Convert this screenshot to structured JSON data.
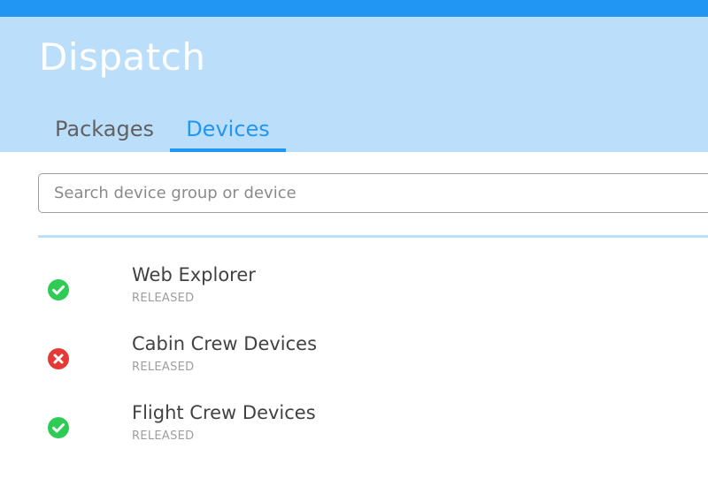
{
  "app": {
    "title": "Dispatch"
  },
  "tabs": [
    {
      "label": "Packages",
      "active": false
    },
    {
      "label": "Devices",
      "active": true
    }
  ],
  "search": {
    "placeholder": "Search device group or device",
    "value": ""
  },
  "devices": [
    {
      "name": "Web Explorer",
      "status": "RELEASED",
      "state_icon": "check-circle-icon",
      "state_color": "#2ecc55"
    },
    {
      "name": "Cabin Crew Devices",
      "status": "RELEASED",
      "state_icon": "x-circle-icon",
      "state_color": "#e53935"
    },
    {
      "name": "Flight Crew Devices",
      "status": "RELEASED",
      "state_icon": "check-circle-icon",
      "state_color": "#2ecc55"
    }
  ],
  "colors": {
    "accent": "#2196f3",
    "header_bg": "#bbdefb",
    "success": "#2ecc55",
    "error": "#e53935"
  }
}
